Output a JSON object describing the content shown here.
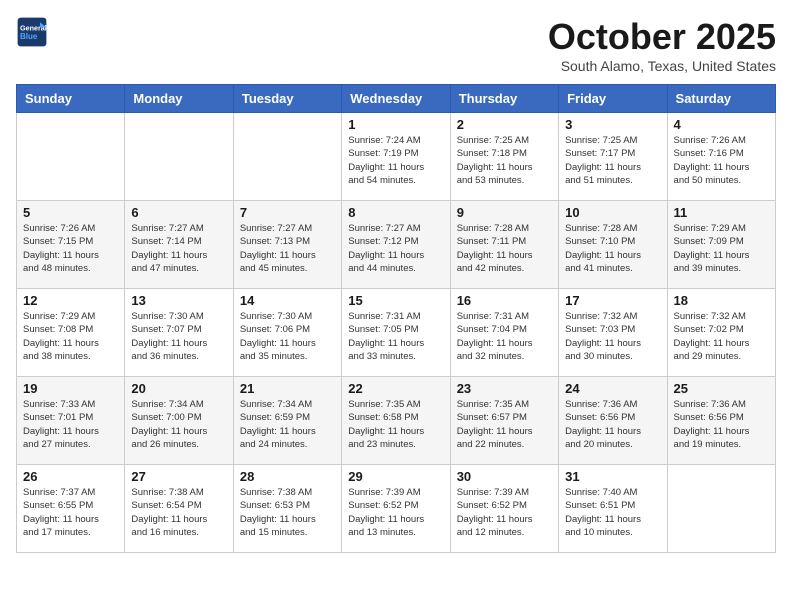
{
  "header": {
    "logo_line1": "General",
    "logo_line2": "Blue",
    "month": "October 2025",
    "location": "South Alamo, Texas, United States"
  },
  "days_of_week": [
    "Sunday",
    "Monday",
    "Tuesday",
    "Wednesday",
    "Thursday",
    "Friday",
    "Saturday"
  ],
  "weeks": [
    [
      {
        "day": "",
        "info": ""
      },
      {
        "day": "",
        "info": ""
      },
      {
        "day": "",
        "info": ""
      },
      {
        "day": "1",
        "info": "Sunrise: 7:24 AM\nSunset: 7:19 PM\nDaylight: 11 hours\nand 54 minutes."
      },
      {
        "day": "2",
        "info": "Sunrise: 7:25 AM\nSunset: 7:18 PM\nDaylight: 11 hours\nand 53 minutes."
      },
      {
        "day": "3",
        "info": "Sunrise: 7:25 AM\nSunset: 7:17 PM\nDaylight: 11 hours\nand 51 minutes."
      },
      {
        "day": "4",
        "info": "Sunrise: 7:26 AM\nSunset: 7:16 PM\nDaylight: 11 hours\nand 50 minutes."
      }
    ],
    [
      {
        "day": "5",
        "info": "Sunrise: 7:26 AM\nSunset: 7:15 PM\nDaylight: 11 hours\nand 48 minutes."
      },
      {
        "day": "6",
        "info": "Sunrise: 7:27 AM\nSunset: 7:14 PM\nDaylight: 11 hours\nand 47 minutes."
      },
      {
        "day": "7",
        "info": "Sunrise: 7:27 AM\nSunset: 7:13 PM\nDaylight: 11 hours\nand 45 minutes."
      },
      {
        "day": "8",
        "info": "Sunrise: 7:27 AM\nSunset: 7:12 PM\nDaylight: 11 hours\nand 44 minutes."
      },
      {
        "day": "9",
        "info": "Sunrise: 7:28 AM\nSunset: 7:11 PM\nDaylight: 11 hours\nand 42 minutes."
      },
      {
        "day": "10",
        "info": "Sunrise: 7:28 AM\nSunset: 7:10 PM\nDaylight: 11 hours\nand 41 minutes."
      },
      {
        "day": "11",
        "info": "Sunrise: 7:29 AM\nSunset: 7:09 PM\nDaylight: 11 hours\nand 39 minutes."
      }
    ],
    [
      {
        "day": "12",
        "info": "Sunrise: 7:29 AM\nSunset: 7:08 PM\nDaylight: 11 hours\nand 38 minutes."
      },
      {
        "day": "13",
        "info": "Sunrise: 7:30 AM\nSunset: 7:07 PM\nDaylight: 11 hours\nand 36 minutes."
      },
      {
        "day": "14",
        "info": "Sunrise: 7:30 AM\nSunset: 7:06 PM\nDaylight: 11 hours\nand 35 minutes."
      },
      {
        "day": "15",
        "info": "Sunrise: 7:31 AM\nSunset: 7:05 PM\nDaylight: 11 hours\nand 33 minutes."
      },
      {
        "day": "16",
        "info": "Sunrise: 7:31 AM\nSunset: 7:04 PM\nDaylight: 11 hours\nand 32 minutes."
      },
      {
        "day": "17",
        "info": "Sunrise: 7:32 AM\nSunset: 7:03 PM\nDaylight: 11 hours\nand 30 minutes."
      },
      {
        "day": "18",
        "info": "Sunrise: 7:32 AM\nSunset: 7:02 PM\nDaylight: 11 hours\nand 29 minutes."
      }
    ],
    [
      {
        "day": "19",
        "info": "Sunrise: 7:33 AM\nSunset: 7:01 PM\nDaylight: 11 hours\nand 27 minutes."
      },
      {
        "day": "20",
        "info": "Sunrise: 7:34 AM\nSunset: 7:00 PM\nDaylight: 11 hours\nand 26 minutes."
      },
      {
        "day": "21",
        "info": "Sunrise: 7:34 AM\nSunset: 6:59 PM\nDaylight: 11 hours\nand 24 minutes."
      },
      {
        "day": "22",
        "info": "Sunrise: 7:35 AM\nSunset: 6:58 PM\nDaylight: 11 hours\nand 23 minutes."
      },
      {
        "day": "23",
        "info": "Sunrise: 7:35 AM\nSunset: 6:57 PM\nDaylight: 11 hours\nand 22 minutes."
      },
      {
        "day": "24",
        "info": "Sunrise: 7:36 AM\nSunset: 6:56 PM\nDaylight: 11 hours\nand 20 minutes."
      },
      {
        "day": "25",
        "info": "Sunrise: 7:36 AM\nSunset: 6:56 PM\nDaylight: 11 hours\nand 19 minutes."
      }
    ],
    [
      {
        "day": "26",
        "info": "Sunrise: 7:37 AM\nSunset: 6:55 PM\nDaylight: 11 hours\nand 17 minutes."
      },
      {
        "day": "27",
        "info": "Sunrise: 7:38 AM\nSunset: 6:54 PM\nDaylight: 11 hours\nand 16 minutes."
      },
      {
        "day": "28",
        "info": "Sunrise: 7:38 AM\nSunset: 6:53 PM\nDaylight: 11 hours\nand 15 minutes."
      },
      {
        "day": "29",
        "info": "Sunrise: 7:39 AM\nSunset: 6:52 PM\nDaylight: 11 hours\nand 13 minutes."
      },
      {
        "day": "30",
        "info": "Sunrise: 7:39 AM\nSunset: 6:52 PM\nDaylight: 11 hours\nand 12 minutes."
      },
      {
        "day": "31",
        "info": "Sunrise: 7:40 AM\nSunset: 6:51 PM\nDaylight: 11 hours\nand 10 minutes."
      },
      {
        "day": "",
        "info": ""
      }
    ]
  ]
}
